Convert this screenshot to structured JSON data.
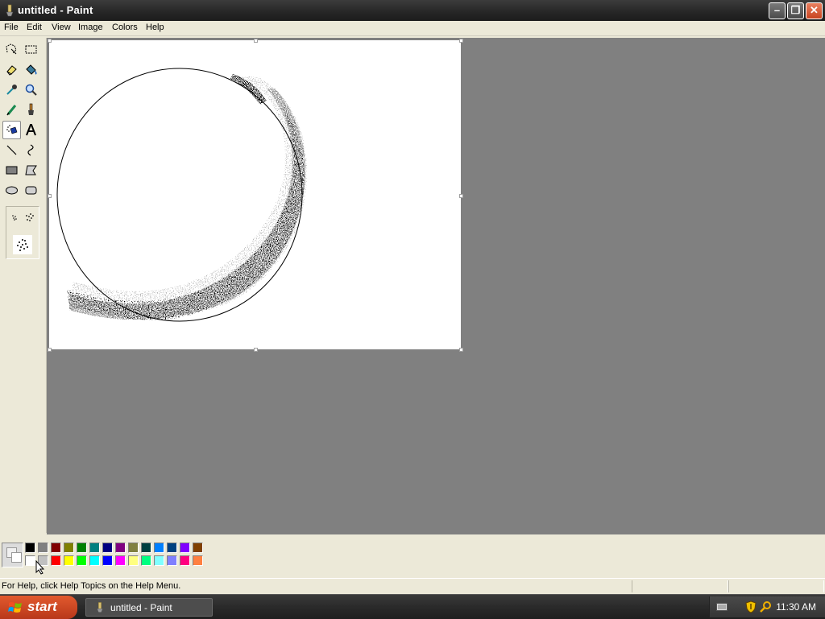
{
  "window": {
    "title": "untitled - Paint",
    "min_symbol": "–",
    "max_symbol": "❐",
    "close_symbol": "✕"
  },
  "menu": {
    "items": [
      "File",
      "Edit",
      "View",
      "Image",
      "Colors",
      "Help"
    ]
  },
  "toolbox": {
    "tools": [
      "free-form-select-icon",
      "select-icon",
      "eraser-icon",
      "fill-icon",
      "pick-color-icon",
      "magnifier-icon",
      "pencil-icon",
      "brush-icon",
      "airbrush-icon",
      "text-icon",
      "line-icon",
      "curve-icon",
      "rectangle-icon",
      "polygon-icon",
      "ellipse-icon",
      "rounded-rectangle-icon"
    ],
    "active_tool": "airbrush-icon"
  },
  "palette": {
    "foreground": "#f0f0f0",
    "background": "#ffffff",
    "row1": [
      "#000000",
      "#808080",
      "#800000",
      "#808000",
      "#008000",
      "#008080",
      "#000080",
      "#800080",
      "#808040",
      "#004040",
      "#0080ff",
      "#004080",
      "#8000ff",
      "#804000"
    ],
    "row2": [
      "#ffffff",
      "#c0c0c0",
      "#ff0000",
      "#ffff00",
      "#00ff00",
      "#00ffff",
      "#0000ff",
      "#ff00ff",
      "#ffff80",
      "#00ff80",
      "#80ffff",
      "#8080ff",
      "#ff0080",
      "#ff8040"
    ]
  },
  "status": {
    "help_text": "For Help, click Help Topics on the Help Menu."
  },
  "taskbar": {
    "start_label": "start",
    "task_label": "untitled - Paint",
    "clock": "11:30 AM"
  }
}
